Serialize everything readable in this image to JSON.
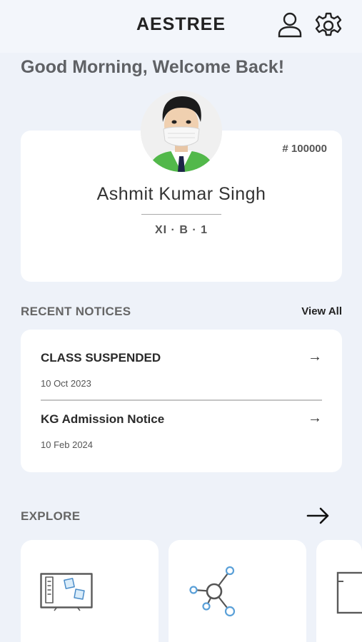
{
  "header": {
    "app_title": "AESTREE",
    "profile_icon": "user-icon",
    "settings_icon": "gear-icon"
  },
  "greeting": "Good Morning, Welcome Back!",
  "student": {
    "id": "# 100000",
    "name": "Ashmit Kumar Singh",
    "class_section": "XI · B · 1",
    "avatar_icon": "student-avatar"
  },
  "notices": {
    "section_title": "RECENT NOTICES",
    "view_all_label": "View All",
    "items": [
      {
        "title": "CLASS SUSPENDED",
        "date": "10 Oct 2023",
        "arrow": "→"
      },
      {
        "title": "KG Admission Notice",
        "date": "10 Feb 2024",
        "arrow": "→"
      }
    ]
  },
  "explore": {
    "section_title": "EXPLORE",
    "arrow_icon": "arrow-right-icon",
    "tiles": [
      {
        "icon": "notice-board-icon"
      },
      {
        "icon": "network-icon"
      },
      {
        "icon": "document-icon"
      }
    ]
  },
  "colors": {
    "background": "#eef2f9",
    "card": "#ffffff",
    "network_accent": "#5aa0d8",
    "avatar_green": "#52b84a"
  }
}
